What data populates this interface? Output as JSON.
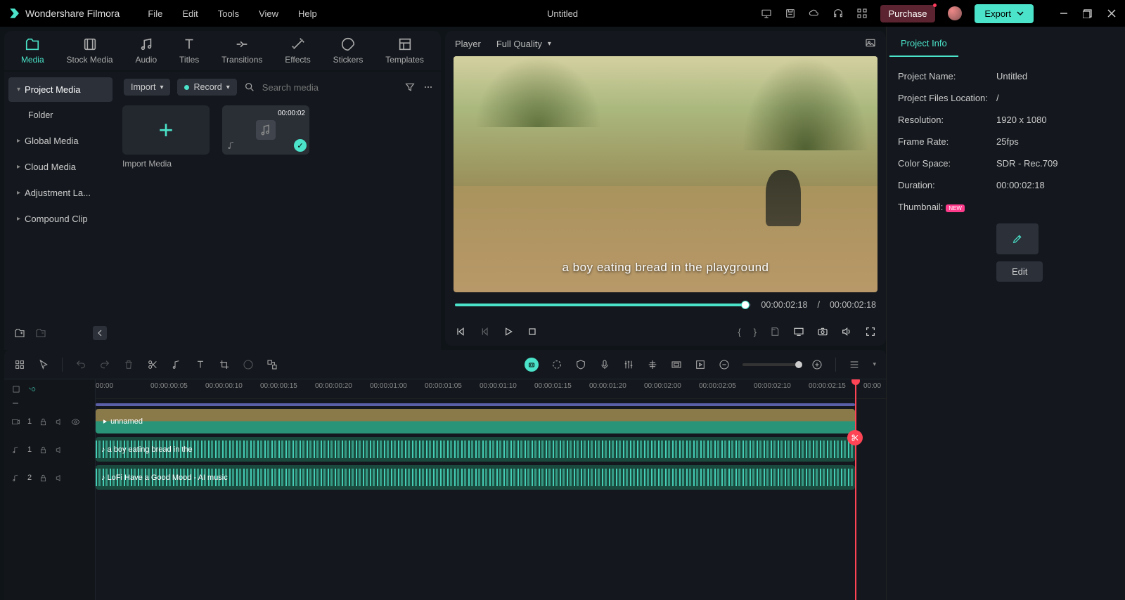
{
  "app": {
    "name": "Wondershare Filmora"
  },
  "menu": {
    "file": "File",
    "edit": "Edit",
    "tools": "Tools",
    "view": "View",
    "help": "Help"
  },
  "title": "Untitled",
  "titlebar": {
    "purchase": "Purchase",
    "export": "Export"
  },
  "mediaTabs": {
    "media": "Media",
    "stock": "Stock Media",
    "audio": "Audio",
    "titles": "Titles",
    "transitions": "Transitions",
    "effects": "Effects",
    "stickers": "Stickers",
    "templates": "Templates"
  },
  "sidebar": {
    "project": "Project Media",
    "folder": "Folder",
    "global": "Global Media",
    "cloud": "Cloud Media",
    "adjust": "Adjustment La...",
    "compound": "Compound Clip"
  },
  "browserToolbar": {
    "import": "Import",
    "record": "Record",
    "searchPlaceholder": "Search media"
  },
  "cards": {
    "import": "Import Media",
    "clip1_time": "00:00:02"
  },
  "player": {
    "tab": "Player",
    "quality": "Full Quality",
    "caption": "a boy eating bread in the playground",
    "currentTime": "00:00:02:18",
    "totalTime": "00:00:02:18",
    "sep": "/"
  },
  "ruler": [
    "00:00",
    "00:00:00:05",
    "00:00:00:10",
    "00:00:00:15",
    "00:00:00:20",
    "00:00:01:00",
    "00:00:01:05",
    "00:00:01:10",
    "00:00:01:15",
    "00:00:01:20",
    "00:00:02:00",
    "00:00:02:05",
    "00:00:02:10",
    "00:00:02:15",
    "00:00"
  ],
  "tracks": {
    "vh1": "1",
    "ah1": "1",
    "ah2": "2",
    "clip_video": "unnamed",
    "clip_a1": "a boy eating bread in the",
    "clip_a2": "LoFi Have a Good Mood - AI music"
  },
  "projectInfo": {
    "tab": "Project Info",
    "nameLabel": "Project Name:",
    "nameVal": "Untitled",
    "locLabel": "Project Files Location:",
    "locVal": "/",
    "resLabel": "Resolution:",
    "resVal": "1920 x 1080",
    "fpsLabel": "Frame Rate:",
    "fpsVal": "25fps",
    "csLabel": "Color Space:",
    "csVal": "SDR - Rec.709",
    "durLabel": "Duration:",
    "durVal": "00:00:02:18",
    "thumbLabel": "Thumbnail:",
    "newBadge": "NEW",
    "editBtn": "Edit"
  }
}
